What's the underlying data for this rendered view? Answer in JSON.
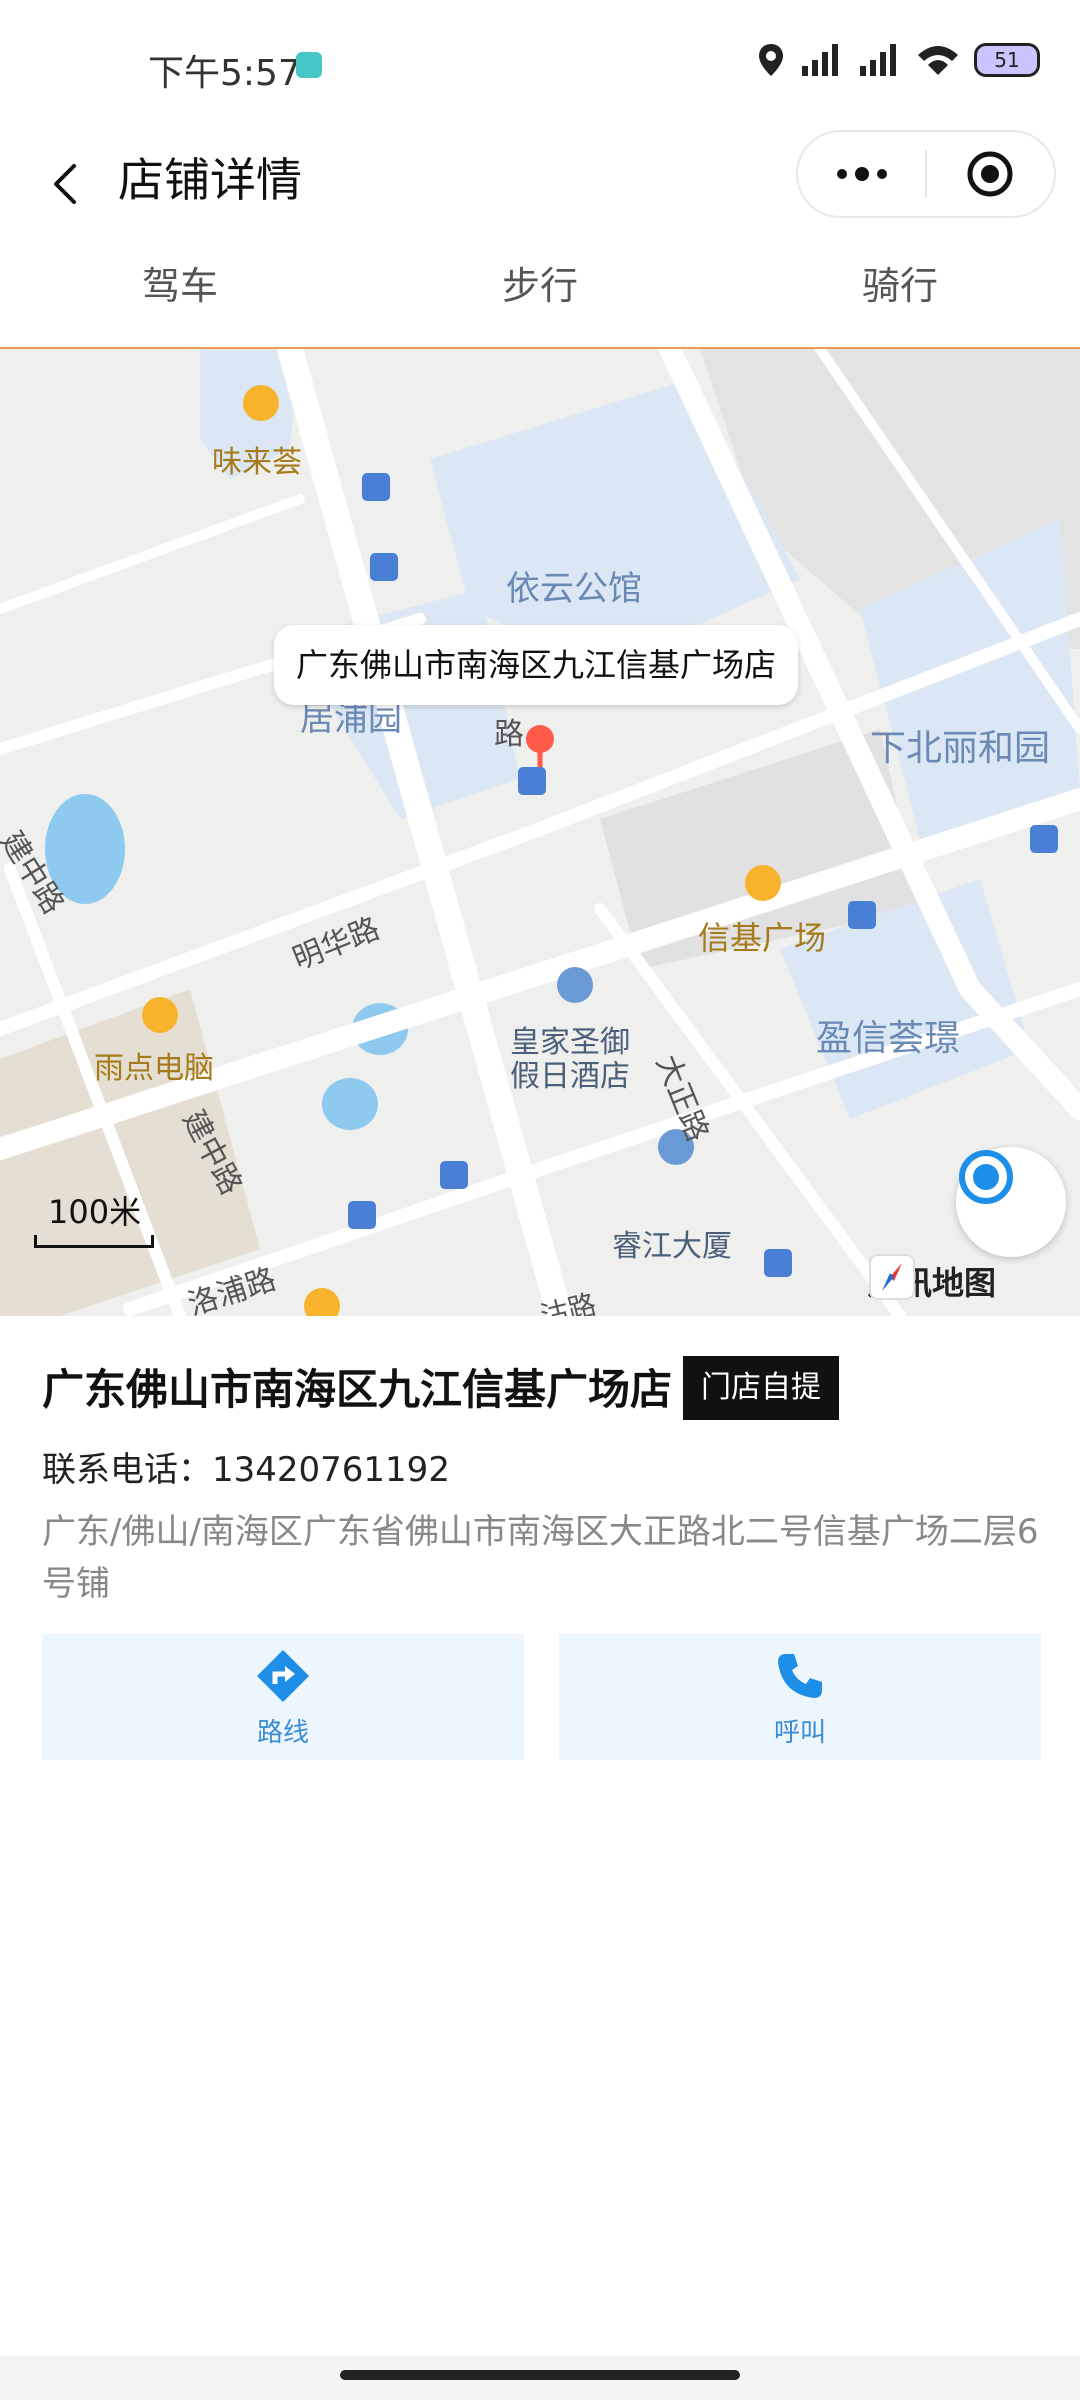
{
  "status_bar": {
    "time": "下午5:57",
    "battery": "51"
  },
  "header": {
    "title": "店铺详情"
  },
  "tabs": [
    {
      "label": "驾车"
    },
    {
      "label": "步行"
    },
    {
      "label": "骑行"
    }
  ],
  "map": {
    "callout": "广东佛山市南海区九江信基广场店",
    "scale": "100米",
    "provider": "腾讯地图",
    "labels": {
      "weilaihui": "味来荟",
      "yiyun": "依云公馆",
      "yupu": "居浦园",
      "xiabei": "下北丽和园",
      "xinji": "信基广场",
      "minghua": "明华路",
      "yuhdian": "雨点电脑",
      "huangjia1": "皇家圣御",
      "huangjia2": "假日酒店",
      "dazheng": "大正路",
      "yingxin": "盈信荟璟",
      "jianzhong1": "建中路",
      "jianzhong2": "建中路",
      "ruijiang": "睿江大厦",
      "lupu": "洛浦路",
      "road_lu": "路",
      "road_bottom": "沽路"
    }
  },
  "store": {
    "name": "广东佛山市南海区九江信基广场店",
    "badge": "门店自提",
    "phone": "联系电话：13420761192",
    "address": "广东/佛山/南海区广东省佛山市南海区大正路北二号信基广场二层6号铺"
  },
  "actions": {
    "route": "路线",
    "call": "呼叫"
  },
  "colors": {
    "accent": "#ef9a55",
    "action_bg": "#eef6fd",
    "action_text": "#3a8cd6"
  }
}
